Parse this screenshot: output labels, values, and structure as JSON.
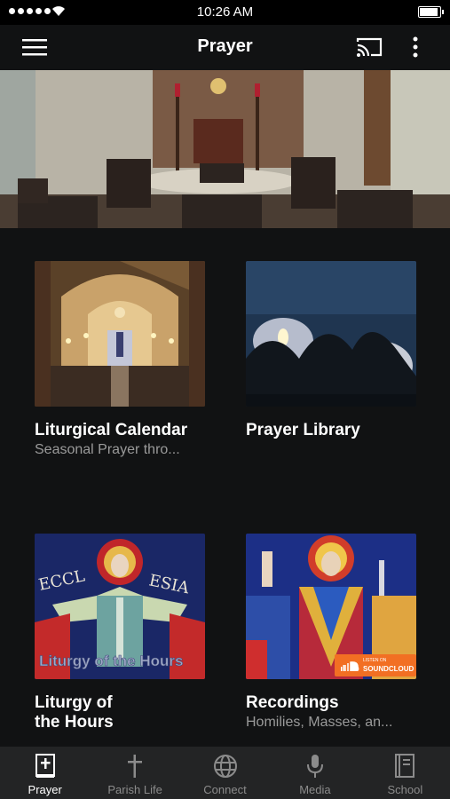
{
  "status_bar": {
    "time": "10:26 AM"
  },
  "header": {
    "title": "Prayer"
  },
  "cards": [
    {
      "title": "Liturgical Calendar",
      "subtitle": "Seasonal Prayer thro..."
    },
    {
      "title": "Prayer Library",
      "subtitle": ""
    },
    {
      "title": "Liturgy of the Hours",
      "subtitle": "",
      "image_caption": "Liturgy of the Hours"
    },
    {
      "title": "Recordings",
      "subtitle": "Homilies, Masses, an...",
      "badge_top": "LISTEN ON",
      "badge_bottom": "SOUNDCLOUD"
    }
  ],
  "tabs": [
    {
      "label": "Prayer",
      "icon": "prayer-book-icon",
      "active": true
    },
    {
      "label": "Parish Life",
      "icon": "cross-icon",
      "active": false
    },
    {
      "label": "Connect",
      "icon": "globe-icon",
      "active": false
    },
    {
      "label": "Media",
      "icon": "microphone-icon",
      "active": false
    },
    {
      "label": "School",
      "icon": "school-book-icon",
      "active": false
    }
  ],
  "colors": {
    "background": "#111213",
    "tabbar": "#232425",
    "soundcloud": "#f26f23"
  }
}
